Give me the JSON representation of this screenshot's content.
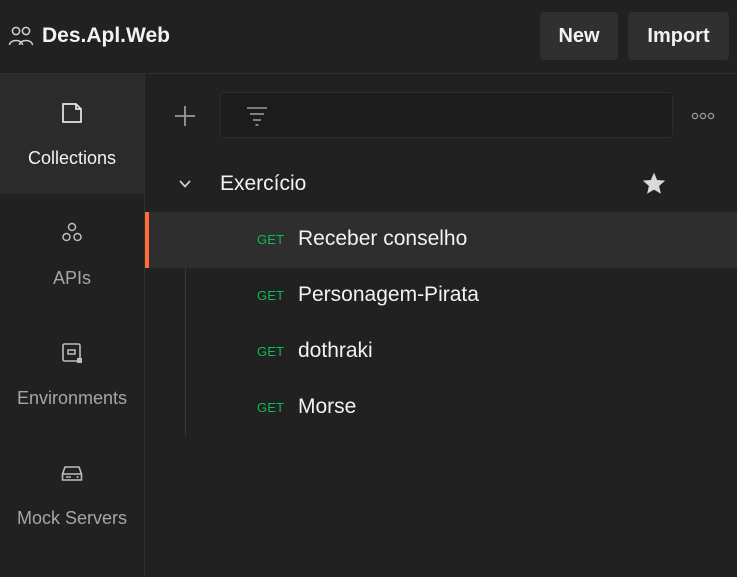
{
  "header": {
    "workspace_name": "Des.Apl.Web",
    "new_label": "New",
    "import_label": "Import"
  },
  "sidebar": {
    "items": [
      {
        "label": "Collections",
        "icon": "collections-icon",
        "active": true
      },
      {
        "label": "APIs",
        "icon": "apis-icon",
        "active": false
      },
      {
        "label": "Environments",
        "icon": "environments-icon",
        "active": false
      },
      {
        "label": "Mock Servers",
        "icon": "mock-servers-icon",
        "active": false
      }
    ]
  },
  "toolbar": {
    "filter_placeholder": ""
  },
  "collection": {
    "name": "Exercício",
    "requests": [
      {
        "method": "GET",
        "name": "Receber conselho",
        "selected": true
      },
      {
        "method": "GET",
        "name": "Personagem-Pirata",
        "selected": false
      },
      {
        "method": "GET",
        "name": "dothraki",
        "selected": false
      },
      {
        "method": "GET",
        "name": "Morse",
        "selected": false
      }
    ]
  },
  "colors": {
    "accent": "#ff6c37",
    "get_method": "#0cbb52",
    "background": "#212121"
  }
}
